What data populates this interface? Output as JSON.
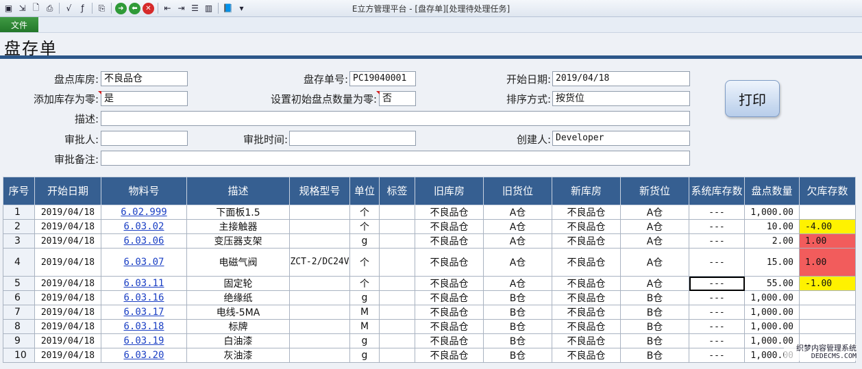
{
  "window": {
    "title": "E立方管理平台 - [盘存单][处理待处理任务]"
  },
  "toolbar": {
    "icons": [
      "save-icon",
      "save-as-icon",
      "preview-icon",
      "print-icon",
      "formula-icon",
      "formula-edit-icon",
      "export-icon",
      "forward-icon",
      "back-icon",
      "close-icon",
      "align-left-icon",
      "align-right-icon",
      "list-icon",
      "columns-icon",
      "book-icon",
      "dropdown-icon"
    ]
  },
  "menu": {
    "file_label": "文件"
  },
  "page": {
    "title": "盘存单"
  },
  "form": {
    "warehouse": {
      "label": "盘点库房:",
      "value": "不良品仓"
    },
    "doc_no": {
      "label": "盘存单号:",
      "value": "PC19040001"
    },
    "start_date": {
      "label": "开始日期:",
      "value": "2019/04/18"
    },
    "add_zero_stock": {
      "label": "添加库存为零:",
      "value": "是"
    },
    "init_zero": {
      "label": "设置初始盘点数量为零:",
      "value": "否"
    },
    "sort": {
      "label": "排序方式:",
      "value": "按货位"
    },
    "desc": {
      "label": "描述:",
      "value": ""
    },
    "approver": {
      "label": "审批人:",
      "value": ""
    },
    "approve_time": {
      "label": "审批时间:",
      "value": ""
    },
    "creator": {
      "label": "创建人:",
      "value": "Developer"
    },
    "approve_note": {
      "label": "审批备注:",
      "value": ""
    }
  },
  "print_label": "打印",
  "table": {
    "headers": [
      "序号",
      "开始日期",
      "物料号",
      "描述",
      "规格型号",
      "单位",
      "标签",
      "旧库房",
      "旧货位",
      "新库房",
      "新货位",
      "系统库存数",
      "盘点数量",
      "欠库存数"
    ],
    "rows": [
      {
        "seq": "1",
        "date": "2019/04/18",
        "mat": "6.02.999",
        "desc": "下面板1.5",
        "spec": "",
        "unit": "个",
        "tag": "",
        "old_wh": "不良品仓",
        "old_loc": "A仓",
        "new_wh": "不良品仓",
        "new_loc": "A仓",
        "sys": "---",
        "count": "1,000.00",
        "short": "",
        "short_style": ""
      },
      {
        "seq": "2",
        "date": "2019/04/18",
        "mat": "6.03.02",
        "desc": "主接触器",
        "spec": "",
        "unit": "个",
        "tag": "",
        "old_wh": "不良品仓",
        "old_loc": "A仓",
        "new_wh": "不良品仓",
        "new_loc": "A仓",
        "sys": "---",
        "count": "10.00",
        "short": "-4.00",
        "short_style": "yellow"
      },
      {
        "seq": "3",
        "date": "2019/04/18",
        "mat": "6.03.06",
        "desc": "变压器支架",
        "spec": "",
        "unit": "g",
        "tag": "",
        "old_wh": "不良品仓",
        "old_loc": "A仓",
        "new_wh": "不良品仓",
        "new_loc": "A仓",
        "sys": "---",
        "count": "2.00",
        "short": "1.00",
        "short_style": "red"
      },
      {
        "seq": "4",
        "date": "2019/04/18",
        "mat": "6.03.07",
        "desc": "电磁气阀",
        "spec": "ZCT-2/DC24V",
        "unit": "个",
        "tag": "",
        "old_wh": "不良品仓",
        "old_loc": "A仓",
        "new_wh": "不良品仓",
        "new_loc": "A仓",
        "sys": "---",
        "count": "15.00",
        "short": "1.00",
        "short_style": "red"
      },
      {
        "seq": "5",
        "date": "2019/04/18",
        "mat": "6.03.11",
        "desc": "固定轮",
        "spec": "",
        "unit": "个",
        "tag": "",
        "old_wh": "不良品仓",
        "old_loc": "A仓",
        "new_wh": "不良品仓",
        "new_loc": "A仓",
        "sys": "---",
        "count": "55.00",
        "short": "-1.00",
        "short_style": "yellow"
      },
      {
        "seq": "6",
        "date": "2019/04/18",
        "mat": "6.03.16",
        "desc": "绝缘纸",
        "spec": "",
        "unit": "g",
        "tag": "",
        "old_wh": "不良品仓",
        "old_loc": "B仓",
        "new_wh": "不良品仓",
        "new_loc": "B仓",
        "sys": "---",
        "count": "1,000.00",
        "short": "",
        "short_style": ""
      },
      {
        "seq": "7",
        "date": "2019/04/18",
        "mat": "6.03.17",
        "desc": "电线-5MA",
        "spec": "",
        "unit": "M",
        "tag": "",
        "old_wh": "不良品仓",
        "old_loc": "B仓",
        "new_wh": "不良品仓",
        "new_loc": "B仓",
        "sys": "---",
        "count": "1,000.00",
        "short": "",
        "short_style": ""
      },
      {
        "seq": "8",
        "date": "2019/04/18",
        "mat": "6.03.18",
        "desc": "标牌",
        "spec": "",
        "unit": "M",
        "tag": "",
        "old_wh": "不良品仓",
        "old_loc": "B仓",
        "new_wh": "不良品仓",
        "new_loc": "B仓",
        "sys": "---",
        "count": "1,000.00",
        "short": "",
        "short_style": ""
      },
      {
        "seq": "9",
        "date": "2019/04/18",
        "mat": "6.03.19",
        "desc": "白油漆",
        "spec": "",
        "unit": "g",
        "tag": "",
        "old_wh": "不良品仓",
        "old_loc": "B仓",
        "new_wh": "不良品仓",
        "new_loc": "B仓",
        "sys": "---",
        "count": "1,000.00",
        "short": "",
        "short_style": ""
      },
      {
        "seq": "10",
        "date": "2019/04/18",
        "mat": "6.03.20",
        "desc": "灰油漆",
        "spec": "",
        "unit": "g",
        "tag": "",
        "old_wh": "不良品仓",
        "old_loc": "B仓",
        "new_wh": "不良品仓",
        "new_loc": "B仓",
        "sys": "---",
        "count": "1,000.00",
        "short": "",
        "short_style": ""
      }
    ]
  },
  "watermark": {
    "line1": "织梦内容管理系统",
    "line2": "DEDECMS.COM"
  },
  "colors": {
    "header_bg": "#365f91",
    "title_rule": "#2c5789",
    "short_warn": "#fff200",
    "short_bad": "#f25c5c",
    "link": "#1a3fc4"
  }
}
